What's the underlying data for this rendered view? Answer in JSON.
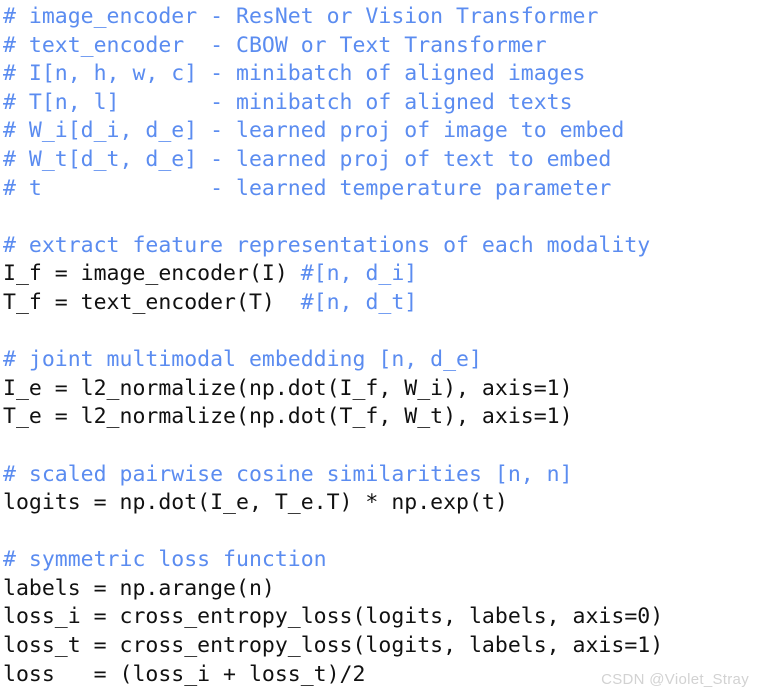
{
  "editor": {
    "background_color": "#ffffff",
    "code_color": "#111111",
    "comment_color": "#5b8cf0",
    "language": "python-pseudocode",
    "lines": [
      {
        "id": "line-1",
        "segments": [
          {
            "kind": "comment",
            "text": "# image_encoder - ResNet or Vision Transformer"
          }
        ]
      },
      {
        "id": "line-2",
        "segments": [
          {
            "kind": "comment",
            "text": "# text_encoder  - CBOW or Text Transformer"
          }
        ]
      },
      {
        "id": "line-3",
        "segments": [
          {
            "kind": "comment",
            "text": "# I[n, h, w, c] - minibatch of aligned images"
          }
        ]
      },
      {
        "id": "line-4",
        "segments": [
          {
            "kind": "comment",
            "text": "# T[n, l]       - minibatch of aligned texts"
          }
        ]
      },
      {
        "id": "line-5",
        "segments": [
          {
            "kind": "comment",
            "text": "# W_i[d_i, d_e] - learned proj of image to embed"
          }
        ]
      },
      {
        "id": "line-6",
        "segments": [
          {
            "kind": "comment",
            "text": "# W_t[d_t, d_e] - learned proj of text to embed"
          }
        ]
      },
      {
        "id": "line-7",
        "segments": [
          {
            "kind": "comment",
            "text": "# t             - learned temperature parameter"
          }
        ]
      },
      {
        "id": "line-8",
        "segments": [
          {
            "kind": "blank",
            "text": ""
          }
        ]
      },
      {
        "id": "line-9",
        "segments": [
          {
            "kind": "comment",
            "text": "# extract feature representations of each modality"
          }
        ]
      },
      {
        "id": "line-10",
        "segments": [
          {
            "kind": "code",
            "text": "I_f = image_encoder(I) "
          },
          {
            "kind": "comment",
            "text": "#[n, d_i]"
          }
        ]
      },
      {
        "id": "line-11",
        "segments": [
          {
            "kind": "code",
            "text": "T_f = text_encoder(T)  "
          },
          {
            "kind": "comment",
            "text": "#[n, d_t]"
          }
        ]
      },
      {
        "id": "line-12",
        "segments": [
          {
            "kind": "blank",
            "text": ""
          }
        ]
      },
      {
        "id": "line-13",
        "segments": [
          {
            "kind": "comment",
            "text": "# joint multimodal embedding [n, d_e]"
          }
        ]
      },
      {
        "id": "line-14",
        "segments": [
          {
            "kind": "code",
            "text": "I_e = l2_normalize(np.dot(I_f, W_i), axis=1)"
          }
        ]
      },
      {
        "id": "line-15",
        "segments": [
          {
            "kind": "code",
            "text": "T_e = l2_normalize(np.dot(T_f, W_t), axis=1)"
          }
        ]
      },
      {
        "id": "line-16",
        "segments": [
          {
            "kind": "blank",
            "text": ""
          }
        ]
      },
      {
        "id": "line-17",
        "segments": [
          {
            "kind": "comment",
            "text": "# scaled pairwise cosine similarities [n, n]"
          }
        ]
      },
      {
        "id": "line-18",
        "segments": [
          {
            "kind": "code",
            "text": "logits = np.dot(I_e, T_e.T) * np.exp(t)"
          }
        ]
      },
      {
        "id": "line-19",
        "segments": [
          {
            "kind": "blank",
            "text": ""
          }
        ]
      },
      {
        "id": "line-20",
        "segments": [
          {
            "kind": "comment",
            "text": "# symmetric loss function"
          }
        ]
      },
      {
        "id": "line-21",
        "segments": [
          {
            "kind": "code",
            "text": "labels = np.arange(n)"
          }
        ]
      },
      {
        "id": "line-22",
        "segments": [
          {
            "kind": "code",
            "text": "loss_i = cross_entropy_loss(logits, labels, axis=0)"
          }
        ]
      },
      {
        "id": "line-23",
        "segments": [
          {
            "kind": "code",
            "text": "loss_t = cross_entropy_loss(logits, labels, axis=1)"
          }
        ]
      },
      {
        "id": "line-24",
        "segments": [
          {
            "kind": "code",
            "text": "loss   = (loss_i + loss_t)/2"
          }
        ]
      }
    ]
  },
  "watermark": {
    "text": "CSDN @Violet_Stray",
    "color": "#d2d2d2"
  }
}
